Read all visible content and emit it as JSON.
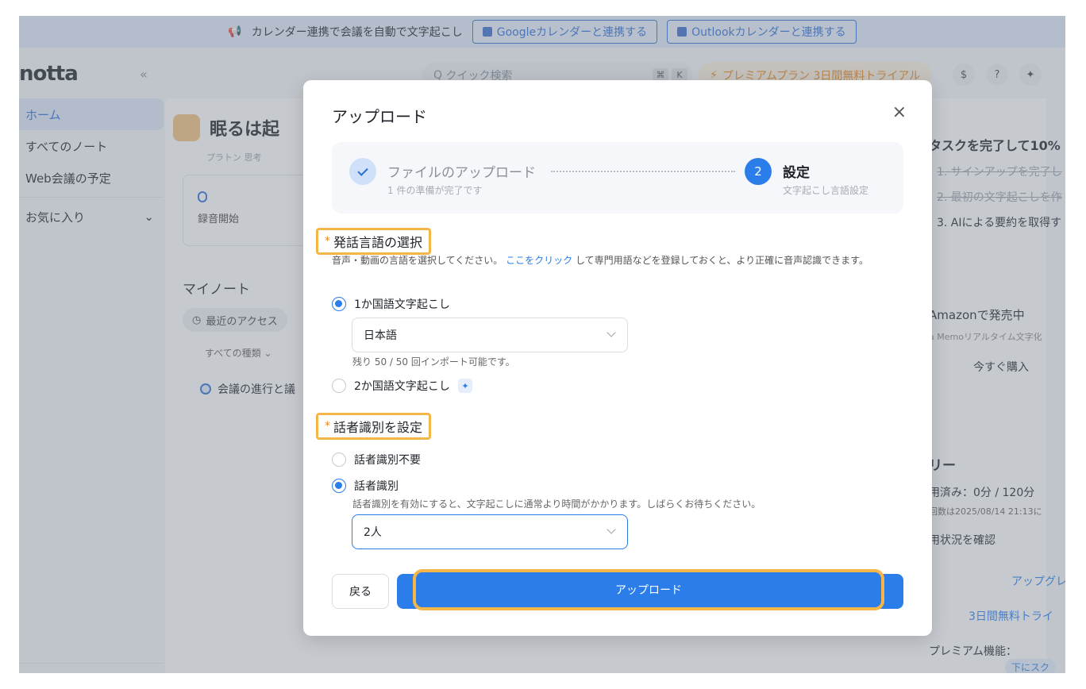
{
  "banner": {
    "text": "カレンダー連携で会議を自動で文字起こし",
    "google_btn": "Googleカレンダーと連携する",
    "outlook_btn": "Outlookカレンダーと連携する"
  },
  "header": {
    "logo": "notta",
    "collapse": "«",
    "search_placeholder": "クイック検索",
    "kbd1": "⌘",
    "kbd2": "K",
    "premium": "プレミアムプラン 3日間無料トライアル"
  },
  "sidebar": {
    "items": [
      {
        "label": "ホーム"
      },
      {
        "label": "すべてのノート"
      },
      {
        "label": "Web会議の予定"
      },
      {
        "label": "お気に入り"
      }
    ]
  },
  "main": {
    "greeting": "眠るは起",
    "quote": "プラトン 思考",
    "record_label": "録音開始",
    "my_notes": "マイノート",
    "recent": "最近のアクセス",
    "kinds": "すべての種類 ⌄",
    "note_item": "会議の進行と議"
  },
  "right_panel": {
    "task_title": "タスクを完了して10%",
    "task1": "1. サインアップを完了し",
    "task2": "2. 最初の文字起こしを作",
    "task3": "3. AIによる要約を取得す",
    "amazon": "Amazonで発売中",
    "memo": "a Memoリアルタイム文字化",
    "buy": "今すぐ購入",
    "usage_title": "リー",
    "usage": "用済み：0分 / 120分",
    "reset": "回数は2025/08/14 21:13に",
    "status": "用状況を確認",
    "upgrade": "アップグレ",
    "trial": "3日間無料トライ",
    "premium_features": "プレミアム機能：",
    "scroll_hint": "下にスク"
  },
  "modal": {
    "title": "アップロード",
    "close": "×",
    "step1": {
      "title": "ファイルのアップロード",
      "sub": "1 件の準備が完了です"
    },
    "step2": {
      "num": "2",
      "title": "設定",
      "sub": "文字起こし言語設定"
    },
    "lang_section": {
      "star": "*",
      "label": "発話言語の選択"
    },
    "lang_desc_1": "音声・動画の言語を選択してください。",
    "lang_desc_link": "ここをクリック",
    "lang_desc_2": "して専門用語などを登録しておくと、より正確に音声認識できます。",
    "radio_mono": "1か国語文字起こし",
    "lang_value": "日本語",
    "remaining": "残り 50 / 50 回インポート可能です。",
    "radio_bi": "2か国語文字起こし",
    "speaker_section": {
      "star": "*",
      "label": "話者識別を設定"
    },
    "radio_no_speaker": "話者識別不要",
    "radio_speaker": "話者識別",
    "speaker_hint": "話者識別を有効にすると、文字起こしに通常より時間がかかります。しばらくお待ちください。",
    "speaker_value": "2人",
    "back": "戻る",
    "upload": "アップロード"
  }
}
